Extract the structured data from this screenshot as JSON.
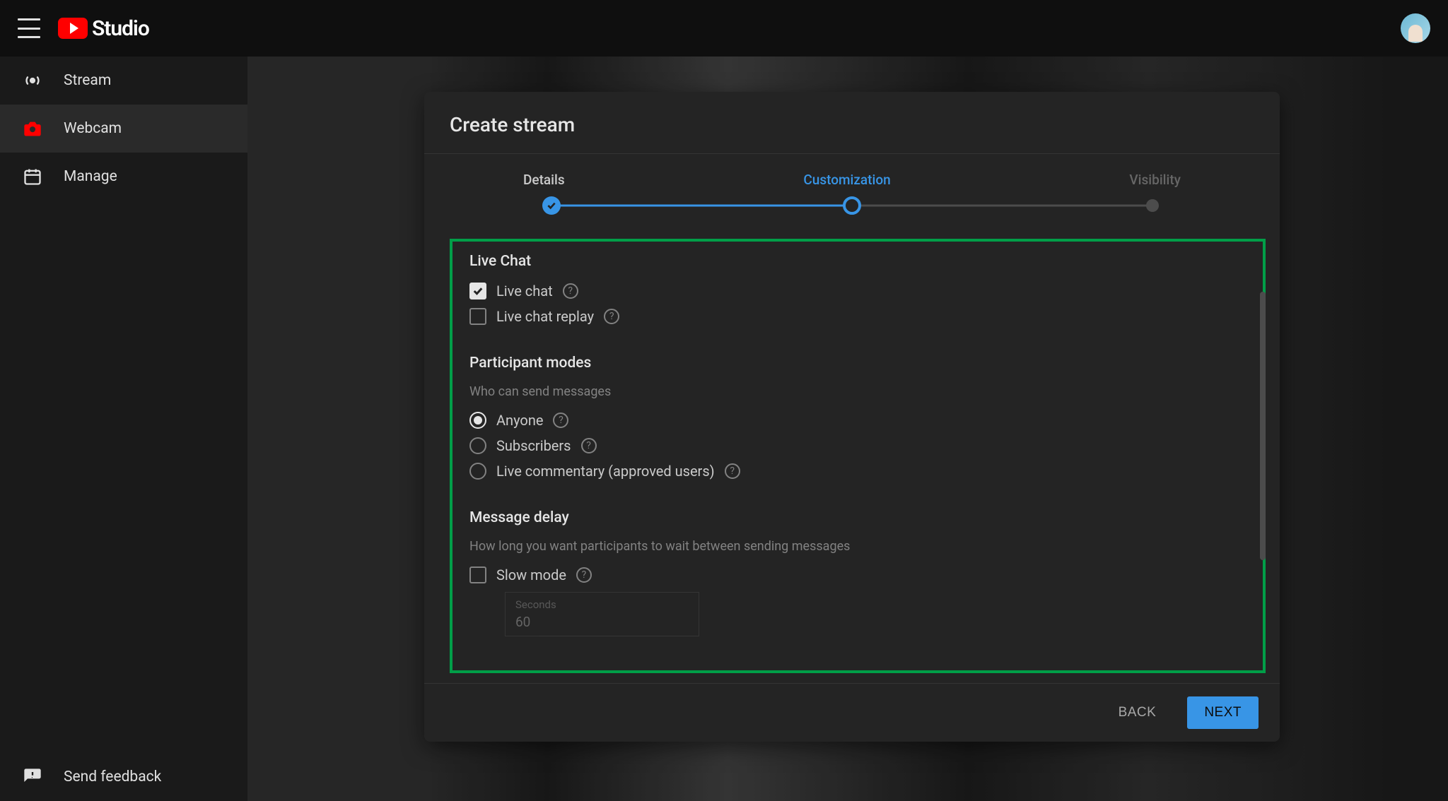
{
  "header": {
    "logo_text": "Studio"
  },
  "sidebar": {
    "stream": "Stream",
    "webcam": "Webcam",
    "manage": "Manage",
    "feedback": "Send feedback"
  },
  "dialog": {
    "title": "Create stream",
    "steps": {
      "details": "Details",
      "customization": "Customization",
      "visibility": "Visibility"
    },
    "live_chat": {
      "title": "Live Chat",
      "chat_label": "Live chat",
      "chat_checked": true,
      "replay_label": "Live chat replay",
      "replay_checked": false
    },
    "participant": {
      "title": "Participant modes",
      "sub": "Who can send messages",
      "anyone": "Anyone",
      "subscribers": "Subscribers",
      "commentary": "Live commentary (approved users)",
      "selected": "anyone"
    },
    "delay": {
      "title": "Message delay",
      "sub": "How long you want participants to wait between sending messages",
      "slow_label": "Slow mode",
      "slow_checked": false,
      "field_label": "Seconds",
      "field_value": "60"
    },
    "footer": {
      "back": "BACK",
      "next": "NEXT"
    }
  }
}
